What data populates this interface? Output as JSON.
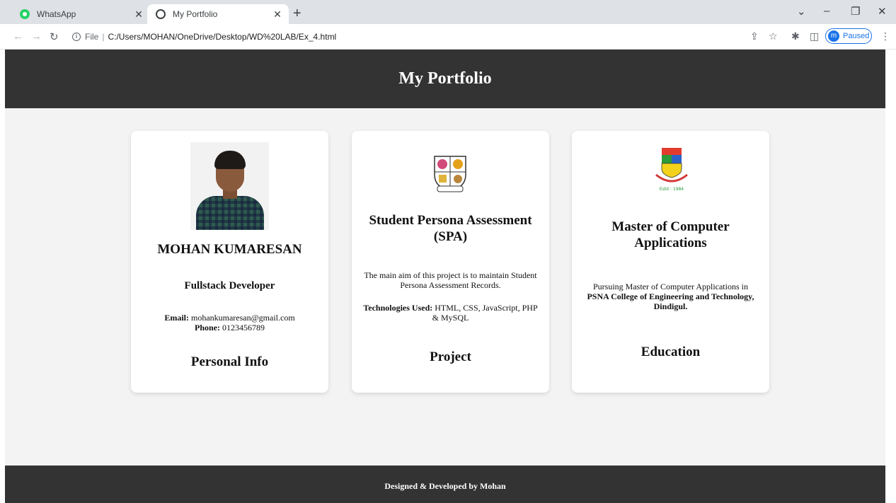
{
  "browser": {
    "tabs": [
      {
        "title": "WhatsApp",
        "active": false
      },
      {
        "title": "My Portfolio",
        "active": true
      }
    ],
    "new_tab_label": "+",
    "url_scheme": "File",
    "url": "C:/Users/MOHAN/OneDrive/Desktop/WD%20LAB/Ex_4.html",
    "profile_initial": "m",
    "profile_status": "Paused"
  },
  "header": {
    "title": "My Portfolio"
  },
  "cards": {
    "personal": {
      "name": "MOHAN KUMARESAN",
      "role": "Fullstack Developer",
      "email_label": "Email:",
      "email": "mohankumaresan@gmail.com",
      "phone_label": "Phone:",
      "phone": "0123456789",
      "section": "Personal Info"
    },
    "project": {
      "title": "Student Persona Assessment (SPA)",
      "description": "The main aim of this project is to maintain Student Persona Assessment Records.",
      "tech_label": "Technologies Used:",
      "tech": "HTML, CSS, JavaScript, PHP & MySQL",
      "section": "Project"
    },
    "education": {
      "title": "Master of Computer Applications",
      "description": "Pursuing Master of Computer Applications in",
      "college": "PSNA College of Engineering and Technology, Dindigul.",
      "logo_caption": "Estd : 1984",
      "section": "Education"
    }
  },
  "footer": {
    "text": "Designed & Developed by Mohan"
  }
}
